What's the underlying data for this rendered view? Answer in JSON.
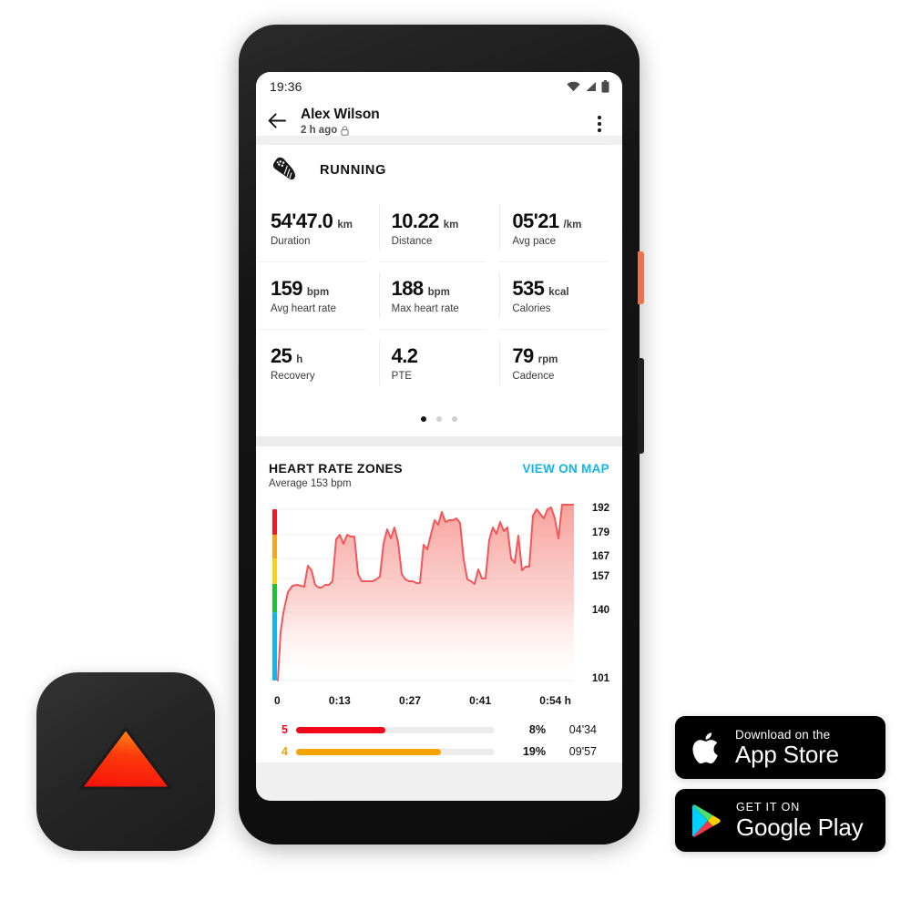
{
  "phone": {
    "status_bar": {
      "time": "19:36",
      "icons": [
        "wifi-icon",
        "signal-icon",
        "battery-icon"
      ]
    },
    "app_bar": {
      "back_icon": "back-arrow-icon",
      "user_name": "Alex Wilson",
      "timestamp": "2 h ago",
      "privacy_icon": "lock-icon",
      "overflow_icon": "kebab-menu-icon"
    },
    "sport": {
      "icon": "running-shoe-icon",
      "label": "RUNNING"
    },
    "stats": [
      {
        "value": "54'47.0",
        "unit": "km",
        "label": "Duration"
      },
      {
        "value": "10.22",
        "unit": "km",
        "label": "Distance"
      },
      {
        "value": "05'21",
        "unit": "/km",
        "label": "Avg pace"
      },
      {
        "value": "159",
        "unit": "bpm",
        "label": "Avg heart rate"
      },
      {
        "value": "188",
        "unit": "bpm",
        "label": "Max heart rate"
      },
      {
        "value": "535",
        "unit": "kcal",
        "label": "Calories"
      },
      {
        "value": "25",
        "unit": "h",
        "label": "Recovery"
      },
      {
        "value": "4.2",
        "unit": "",
        "label": "PTE"
      },
      {
        "value": "79",
        "unit": "rpm",
        "label": "Cadence"
      }
    ],
    "pager": {
      "count": 3,
      "active": 0
    },
    "heart_rate": {
      "title": "HEART RATE ZONES",
      "subtitle": "Average 153 bpm",
      "map_link": "VIEW ON MAP",
      "zones": [
        {
          "number": "5",
          "percent": "8%",
          "time": "04'34",
          "fill": 0.45,
          "color": "#f2071b"
        },
        {
          "number": "4",
          "percent": "19%",
          "time": "09'57",
          "fill": 0.73,
          "color": "#f5a300"
        }
      ]
    }
  },
  "chart_data": {
    "type": "area",
    "title": "HEART RATE ZONES",
    "subtitle": "Average 153 bpm",
    "xlabel": "h",
    "ylabel": "bpm",
    "ylim": [
      101,
      192
    ],
    "ytick_labels": [
      "192",
      "179",
      "167",
      "157",
      "140",
      "101"
    ],
    "ytick_values": [
      192,
      179,
      167,
      157,
      140,
      101
    ],
    "xtick_labels": [
      "0",
      "0:13",
      "0:27",
      "0:41",
      "0:54 h"
    ],
    "xtick_values": [
      0,
      13,
      27,
      41,
      54
    ],
    "grid": true,
    "legend": "none",
    "line_color": "#f4565a",
    "fill_gradient": [
      "#f9a8a6",
      "#ffffff"
    ],
    "zone_bands": [
      {
        "name": "zone5",
        "color": "#ef1a21",
        "from": 181,
        "to": 192
      },
      {
        "name": "zone4",
        "color": "#f5a623",
        "from": 170,
        "to": 181
      },
      {
        "name": "zone3",
        "color": "#f8d11a",
        "from": 159,
        "to": 170
      },
      {
        "name": "zone2",
        "color": "#1fc033",
        "from": 144,
        "to": 159
      },
      {
        "name": "zone1",
        "color": "#13b5ea",
        "from": 101,
        "to": 144
      }
    ],
    "series": [
      {
        "name": "Heart rate",
        "units": "bpm",
        "x": [
          0,
          0.5,
          1,
          1.7,
          2.4,
          3,
          3.6,
          4.1,
          4.7,
          5.3,
          5.9,
          6.3,
          6.8,
          7.2,
          7.7,
          8.3,
          8.9,
          9.4,
          10,
          10.6,
          11.2,
          11.8,
          12.4,
          13,
          13.6,
          14.2,
          14.8,
          15.4,
          16,
          16.6,
          17.2,
          17.8,
          18.4,
          19,
          19.6,
          20.2,
          20.8,
          21.4,
          22,
          22.6,
          23.2,
          23.8,
          24.4,
          25,
          25.6,
          26.2,
          26.8,
          27.4,
          28,
          28.6,
          29.2,
          29.8,
          30.4,
          31,
          31.6,
          32.2,
          32.8,
          33.4,
          34,
          34.6,
          35.2,
          35.8,
          36.4,
          37,
          37.6,
          38.2,
          38.8,
          39.4,
          40,
          40.6,
          41.2,
          41.8,
          42.4,
          43,
          43.6,
          44.2,
          44.8,
          45.4,
          46,
          46.6,
          47.2,
          47.8,
          48.4,
          49,
          49.6,
          50.2,
          50.8,
          51.4,
          52,
          52.6,
          53.2,
          54
        ],
        "values": [
          101,
          110,
          132,
          140,
          141,
          140,
          140,
          139,
          151,
          148,
          141,
          139,
          139,
          141,
          141,
          143,
          161,
          163,
          159,
          163,
          162,
          162,
          146,
          143,
          143,
          143,
          143,
          144,
          145,
          159,
          165,
          161,
          166,
          160,
          146,
          144,
          143,
          143,
          142,
          142,
          158,
          156,
          162,
          168,
          166,
          172,
          167,
          168,
          168,
          169,
          167,
          151,
          142,
          141,
          140,
          146,
          143,
          143,
          160,
          166,
          163,
          168,
          164,
          166,
          152,
          150,
          162,
          147,
          149,
          149,
          176,
          179,
          177,
          175,
          179,
          180,
          175,
          166,
          185,
          186,
          186,
          186,
          181,
          159,
          157,
          157,
          157,
          157,
          157,
          164,
          156,
          160,
          163,
          166
        ]
      }
    ]
  },
  "app_icon": {
    "name": "suunto-app-icon",
    "background": "#262626",
    "glyph": "triangle",
    "glyph_gradient": [
      "#ff7a18",
      "#f81e0c"
    ]
  },
  "store_badges": [
    {
      "id": "apple-app-store-badge",
      "icon": "apple-logo-icon",
      "small_text": "Download on the",
      "big_text": "App Store"
    },
    {
      "id": "google-play-badge",
      "icon": "google-play-icon",
      "small_text": "GET IT ON",
      "big_text": "Google Play"
    }
  ]
}
